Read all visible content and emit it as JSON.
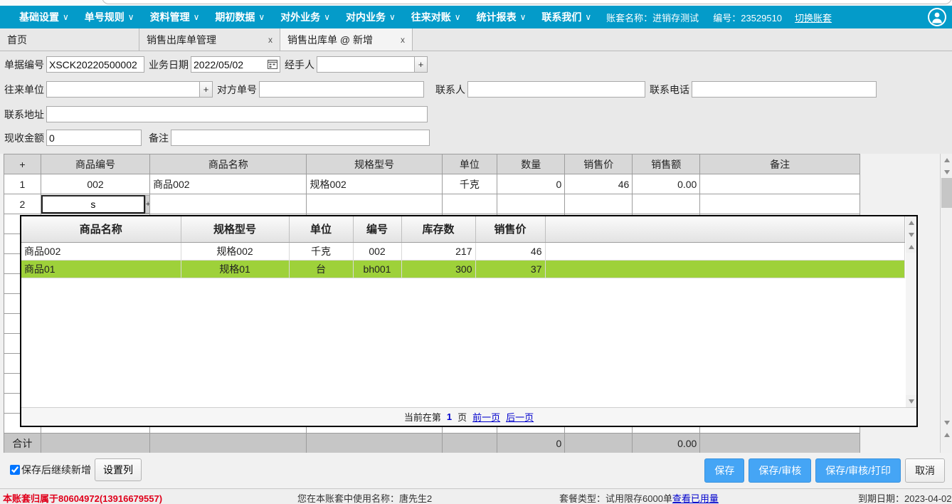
{
  "navbar": {
    "items": [
      {
        "label": "基础设置",
        "caret": "∨"
      },
      {
        "label": "单号规则",
        "caret": "∨"
      },
      {
        "label": "资料管理",
        "caret": "∨"
      },
      {
        "label": "期初数据",
        "caret": "∨"
      },
      {
        "label": "对外业务",
        "caret": "∨"
      },
      {
        "label": "对内业务",
        "caret": "∨"
      },
      {
        "label": "往来对账",
        "caret": "∨"
      },
      {
        "label": "统计报表",
        "caret": "∨"
      },
      {
        "label": "联系我们",
        "caret": "∨"
      }
    ],
    "book_name": "账套名称：进销存测试",
    "book_id": "编号：23529510",
    "switch_book": "切换账套",
    "accent": "#049bc9"
  },
  "tabs": [
    {
      "label": "首页",
      "closable": false,
      "active": false
    },
    {
      "label": "销售出库单管理",
      "close": "x",
      "closable": true,
      "active": false
    },
    {
      "label": "销售出库单 @ 新增",
      "close": "x",
      "closable": true,
      "active": true
    }
  ],
  "form": {
    "doc_no_label": "单据编号",
    "doc_no_value": "XSCK20220500002",
    "date_label": "业务日期",
    "date_value": "2022/05/02",
    "handler_label": "经手人",
    "handler_value": "",
    "add_btn": "+",
    "partner_label": "往来单位",
    "partner_value": "",
    "their_no_label": "对方单号",
    "their_no_value": "",
    "contact_label": "联系人",
    "contact_value": "",
    "phone_label": "联系电话",
    "phone_value": "",
    "address_label": "联系地址",
    "address_value": "",
    "cash_label": "现收金额",
    "cash_value": "0",
    "memo_label": "备注",
    "memo_value": ""
  },
  "grid": {
    "headers": [
      "+",
      "商品编号",
      "商品名称",
      "规格型号",
      "单位",
      "数量",
      "销售价",
      "销售额",
      "备注"
    ],
    "rows": [
      {
        "no": "1",
        "code": "002",
        "name": "商品002",
        "spec": "规格002",
        "unit": "千克",
        "qty": "0",
        "price": "46",
        "amount": "0.00",
        "memo": ""
      }
    ],
    "editing_row": {
      "no": "2",
      "code_value": "s",
      "plus": "+"
    },
    "total": {
      "label": "合计",
      "qty": "0",
      "amount": "0.00"
    }
  },
  "popup": {
    "headers": [
      "商品名称",
      "规格型号",
      "单位",
      "编号",
      "库存数",
      "销售价"
    ],
    "rows": [
      {
        "name": "商品002",
        "spec": "规格002",
        "unit": "千克",
        "code": "002",
        "stock": "217",
        "price": "46",
        "selected": false
      },
      {
        "name": "商品01",
        "spec": "规格01",
        "unit": "台",
        "code": "bh001",
        "stock": "300",
        "price": "37",
        "selected": true
      }
    ],
    "selected_color": "#9ed13a",
    "footer": {
      "prefix": "当前在第",
      "page": "1",
      "suffix": "页",
      "prev": "前一页",
      "next": "后一页"
    }
  },
  "toolbar": {
    "continue_new_label": "保存后继续新增",
    "continue_new_checked": true,
    "set_columns": "设置列",
    "save": "保存",
    "save_audit": "保存/审核",
    "save_audit_print": "保存/审核/打印",
    "cancel": "取消",
    "primary_color": "#45a5f5"
  },
  "footer": {
    "owner": "本账套归属于80604972(13916679557)",
    "owner_color": "#e0001b",
    "username": "您在本账套中使用名称：唐先生2",
    "plan_prefix": "套餐类型：试用限存6000单",
    "plan_link": "查看已用量",
    "expiry": "到期日期：2023-04-02"
  }
}
